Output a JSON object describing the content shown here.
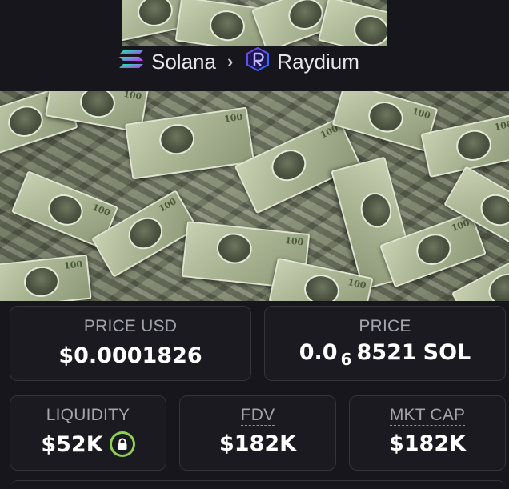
{
  "breadcrumb": {
    "chain": "Solana",
    "separator": "›",
    "dex": "Raydium"
  },
  "stats": {
    "price_usd": {
      "label": "PRICE USD",
      "value": "$0.0001826"
    },
    "price_sol": {
      "label": "PRICE",
      "prefix": "0.0",
      "zeros": "6",
      "digits": "8521",
      "unit": "SOL"
    },
    "liquidity": {
      "label": "LIQUIDITY",
      "value": "$52K",
      "locked": true
    },
    "fdv": {
      "label": "FDV",
      "value": "$182K"
    },
    "mkt_cap": {
      "label": "MKT CAP",
      "value": "$182K"
    }
  },
  "colors": {
    "background": "#16161c",
    "card": "#1a1a20",
    "label": "#a3a4ad",
    "lock_green": "#8fd14f"
  },
  "icons": {
    "chain": "solana-logo-icon",
    "dex": "raydium-logo-icon",
    "separator": "chevron-right-icon",
    "liquidity_lock": "lock-icon"
  }
}
